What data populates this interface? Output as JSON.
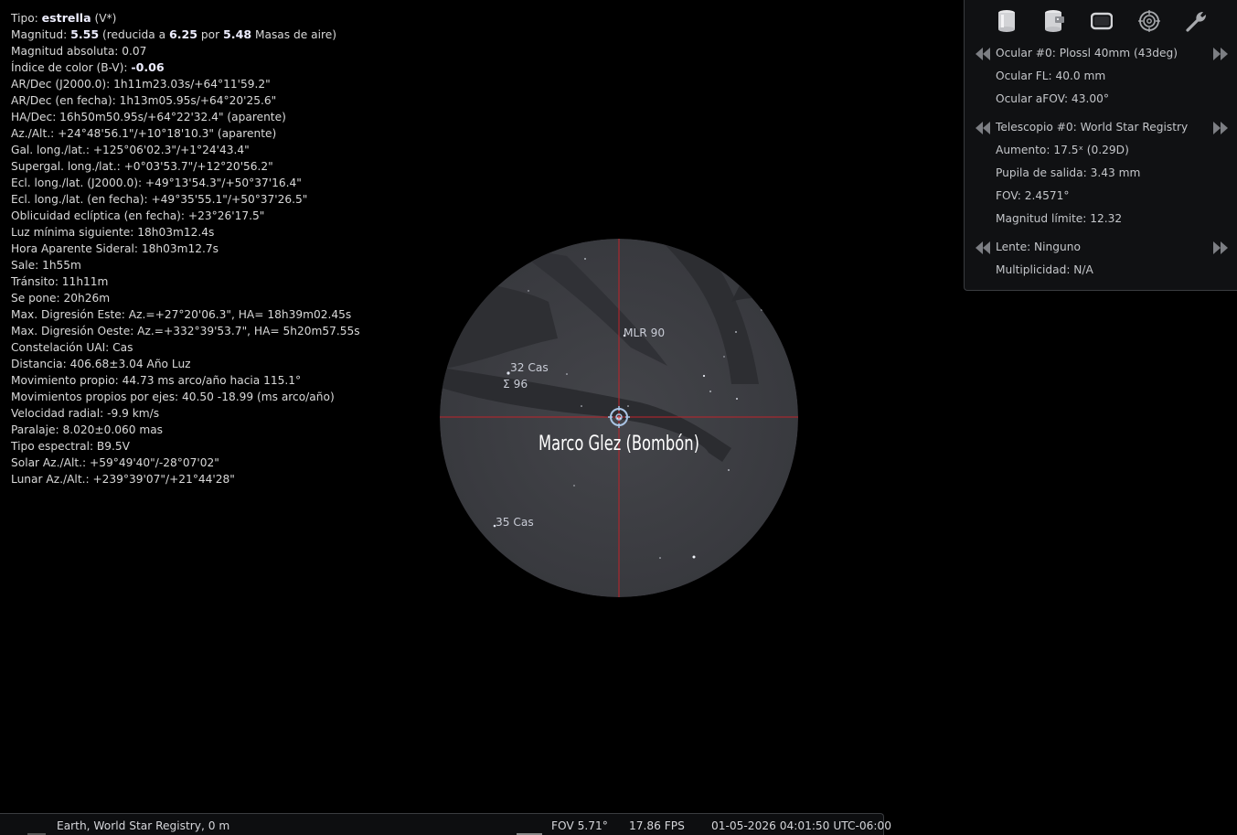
{
  "info": {
    "lines": [
      {
        "pre": "Tipo: ",
        "b1": "estrella",
        "mid1": " (V*)",
        "b2": "",
        "mid2": "",
        "b3": "",
        "post": ""
      },
      {
        "pre": "Magnitud: ",
        "b1": "5.55",
        "mid1": " (reducida a ",
        "b2": "6.25",
        "mid2": " por ",
        "b3": "5.48",
        "post": " Masas de aire)"
      },
      {
        "pre": "Magnitud absoluta: 0.07"
      },
      {
        "pre": "Índice de color (B-V): ",
        "b1": "-0.06"
      },
      {
        "pre": "AR/Dec (J2000.0): 1h11m23.03s/+64°11'59.2\""
      },
      {
        "pre": "AR/Dec (en fecha): 1h13m05.95s/+64°20'25.6\""
      },
      {
        "pre": "HA/Dec: 16h50m50.95s/+64°22'32.4\" (aparente)"
      },
      {
        "pre": "Az./Alt.: +24°48'56.1\"/+10°18'10.3\" (aparente)"
      },
      {
        "pre": "Gal. long./lat.: +125°06'02.3\"/+1°24'43.4\""
      },
      {
        "pre": "Supergal. long./lat.: +0°03'53.7\"/+12°20'56.2\""
      },
      {
        "pre": "Ecl. long./lat. (J2000.0): +49°13'54.3\"/+50°37'16.4\""
      },
      {
        "pre": "Ecl. long./lat. (en fecha): +49°35'55.1\"/+50°37'26.5\""
      },
      {
        "pre": "Oblicuidad eclíptica (en fecha): +23°26'17.5\""
      },
      {
        "pre": "Luz mínima siguiente: 18h03m12.4s"
      },
      {
        "pre": "Hora Aparente Sideral: 18h03m12.7s"
      },
      {
        "pre": "Sale: 1h55m"
      },
      {
        "pre": "Tránsito: 11h11m"
      },
      {
        "pre": "Se pone: 20h26m"
      },
      {
        "pre": "Max. Digresión Este: Az.=+27°20'06.3\", HA= 18h39m02.45s"
      },
      {
        "pre": "Max. Digresión Oeste: Az.=+332°39'53.7\", HA= 5h20m57.55s"
      },
      {
        "pre": "Constelación UAI: Cas"
      },
      {
        "pre": "Distancia: 406.68±3.04 Año Luz"
      },
      {
        "pre": "Movimiento propio: 44.73 ms arco/año hacia 115.1°"
      },
      {
        "pre": "Movimientos propios por ejes: 40.50 -18.99 (ms arco/año)"
      },
      {
        "pre": "Velocidad radial: -9.9 km/s"
      },
      {
        "pre": "Paralaje: 8.020±0.060 mas"
      },
      {
        "pre": "Tipo espectral: B9.5V"
      },
      {
        "pre": "Solar Az./Alt.: +59°49'40\"/-28°07'02\""
      },
      {
        "pre": "Lunar Az./Alt.: +239°39'07\"/+21°44'28\""
      }
    ]
  },
  "view": {
    "target_name": "Marco Glez (Bombón)",
    "labels": {
      "mlr90": "MLR 90",
      "cas32": "32 Cas",
      "sigma96": "Σ 96",
      "cas35": "35 Cas"
    },
    "colors": {
      "crosshair": "#c0242b",
      "field_bg": "#3f4045"
    }
  },
  "oculars": {
    "toolbar_icons": [
      "ocular-icon",
      "ccd-sensor-icon",
      "telrad-icon",
      "crosshair-icon",
      "wrench-icon"
    ],
    "ocular": {
      "name": "Ocular #0: Plossl 40mm (43deg)",
      "fl": "Ocular FL: 40.0 mm",
      "afov": "Ocular aFOV: 43.00°"
    },
    "telescope": {
      "name": "Telescopio #0: World Star Registry",
      "magnification": "Aumento: 17.5ˣ (0.29D)",
      "exit_pupil": "Pupila de salida: 3.43 mm",
      "fov": "FOV: 2.4571°",
      "limit_mag": "Magnitud límite: 12.32"
    },
    "lens": {
      "name": "Lente: Ninguno",
      "multiplicity": "Multiplicidad: N/A"
    }
  },
  "status": {
    "location": "Earth, World Star Registry, 0 m",
    "fov": "FOV 5.71°",
    "fps": "17.86 FPS",
    "datetime": "01-05-2026 04:01:50 UTC-06:00"
  }
}
